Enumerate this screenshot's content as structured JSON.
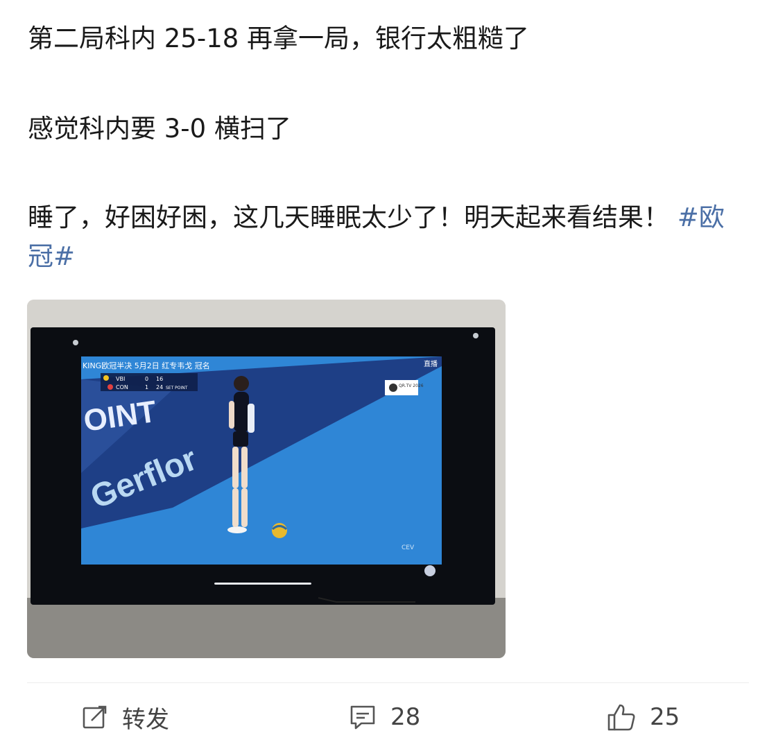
{
  "post": {
    "line1": "第二局科内 25-18 再拿一局，银行太粗糙了",
    "line2": "感觉科内要 3-0 横扫了",
    "line3_text": "睡了，好困好困，这几天睡眠太少了！明天起来看结果！",
    "hashtag": "#欧冠#"
  },
  "image": {
    "broadcast_title": "KING欧冠半决  5月2日  红专韦戈  冠名",
    "live_label": "直播",
    "team1": "VBI",
    "team1_sets": "0",
    "team1_points": "16",
    "team2": "CON",
    "team2_sets": "1",
    "team2_points": "24",
    "set_point": "SET POINT",
    "ad_text_wall": "OINT",
    "ad_text_floor": "Gerflor",
    "channel_logo": "QR.TV 2026",
    "watermark": "CEV"
  },
  "actions": {
    "repost_label": "转发",
    "comment_count": "28",
    "like_count": "25"
  },
  "colors": {
    "hashtag": "#4b6fa6",
    "court": "#2f86d6",
    "text": "#1a1a1a"
  }
}
